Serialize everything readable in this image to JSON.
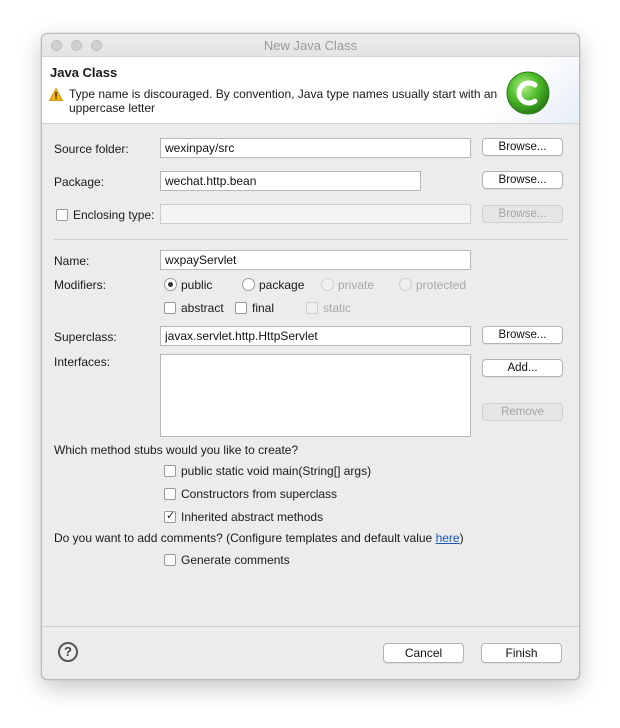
{
  "window": {
    "title": "New Java Class"
  },
  "header": {
    "title": "Java Class",
    "message": "Type name is discouraged. By convention, Java type names usually start with an uppercase letter"
  },
  "source_folder": {
    "label": "Source folder:",
    "value": "wexinpay/src",
    "browse": "Browse..."
  },
  "package": {
    "label": "Package:",
    "value": "wechat.http.bean",
    "browse": "Browse..."
  },
  "enclosing_type": {
    "label": "Enclosing type:",
    "checked": false,
    "value": "",
    "browse": "Browse..."
  },
  "name": {
    "label": "Name:",
    "value": "wxpayServlet"
  },
  "modifiers": {
    "label": "Modifiers:",
    "access": [
      {
        "label": "public",
        "selected": true,
        "enabled": true
      },
      {
        "label": "package",
        "selected": false,
        "enabled": true
      },
      {
        "label": "private",
        "selected": false,
        "enabled": false
      },
      {
        "label": "protected",
        "selected": false,
        "enabled": false
      }
    ],
    "flags": [
      {
        "label": "abstract",
        "checked": false,
        "enabled": true
      },
      {
        "label": "final",
        "checked": false,
        "enabled": true
      },
      {
        "label": "static",
        "checked": false,
        "enabled": false
      }
    ]
  },
  "superclass": {
    "label": "Superclass:",
    "value": "javax.servlet.http.HttpServlet",
    "browse": "Browse..."
  },
  "interfaces": {
    "label": "Interfaces:",
    "add": "Add...",
    "remove": "Remove"
  },
  "stubs": {
    "question": "Which method stubs would you like to create?",
    "options": [
      {
        "label": "public static void main(String[] args)",
        "checked": false
      },
      {
        "label": "Constructors from superclass",
        "checked": false
      },
      {
        "label": "Inherited abstract methods",
        "checked": true
      }
    ]
  },
  "comments": {
    "question_prefix": "Do you want to add comments? (Configure templates and default value ",
    "link": "here",
    "question_suffix": ")",
    "option": {
      "label": "Generate comments",
      "checked": false
    }
  },
  "footer": {
    "help": "?",
    "cancel": "Cancel",
    "finish": "Finish"
  },
  "icons": {
    "warning": "warning-icon",
    "logo": "new-class-wizard-icon",
    "help": "help-icon",
    "check": "✓"
  },
  "colors": {
    "link": "#1a55b3",
    "logo_green": "#45b52b"
  }
}
